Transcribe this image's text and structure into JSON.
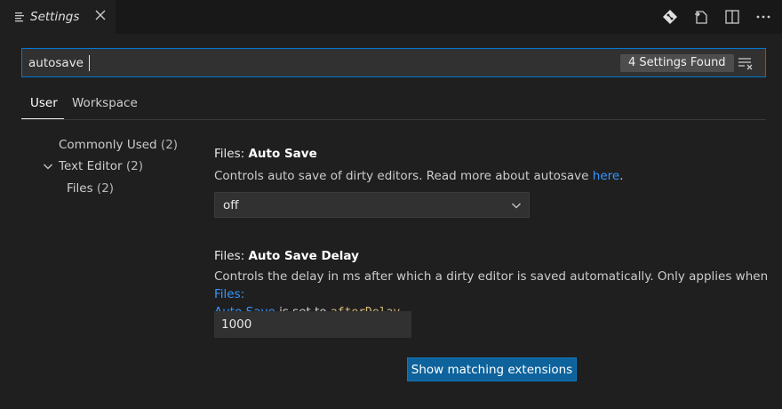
{
  "tab": {
    "title": "Settings"
  },
  "header_actions": [
    "open-changes-icon",
    "open-json-icon",
    "split-editor-icon",
    "more-actions-icon"
  ],
  "search": {
    "value": "autosave",
    "result_count": "4 Settings Found"
  },
  "scope_tabs": [
    {
      "label": "User",
      "active": true
    },
    {
      "label": "Workspace",
      "active": false
    }
  ],
  "toc": {
    "commonly_used": {
      "label": "Commonly Used",
      "count": "(2)"
    },
    "text_editor": {
      "label": "Text Editor",
      "count": "(2)"
    },
    "files": {
      "label": "Files",
      "count": "(2)"
    }
  },
  "settings": {
    "auto_save": {
      "category": "Files: ",
      "name": "Auto Save",
      "description": "Controls auto save of dirty editors. Read more about autosave ",
      "link": "here",
      "after_link": ".",
      "value": "off"
    },
    "auto_save_delay": {
      "category": "Files: ",
      "name": "Auto Save Delay",
      "desc_line1_a": "Controls the delay in ms after which a dirty editor is saved automatically. Only applies when ",
      "desc_link_part1": "Files:",
      "desc_link_part2": "Auto Save",
      "desc_line2_b": " is set to ",
      "desc_code": "afterDelay",
      "desc_end": ".",
      "value": "1000"
    }
  },
  "show_extensions_button": "Show matching extensions",
  "colors": {
    "accent": "#0078d4",
    "link": "#3794ff",
    "button": "#0e639c",
    "background": "#1f1f1f"
  }
}
